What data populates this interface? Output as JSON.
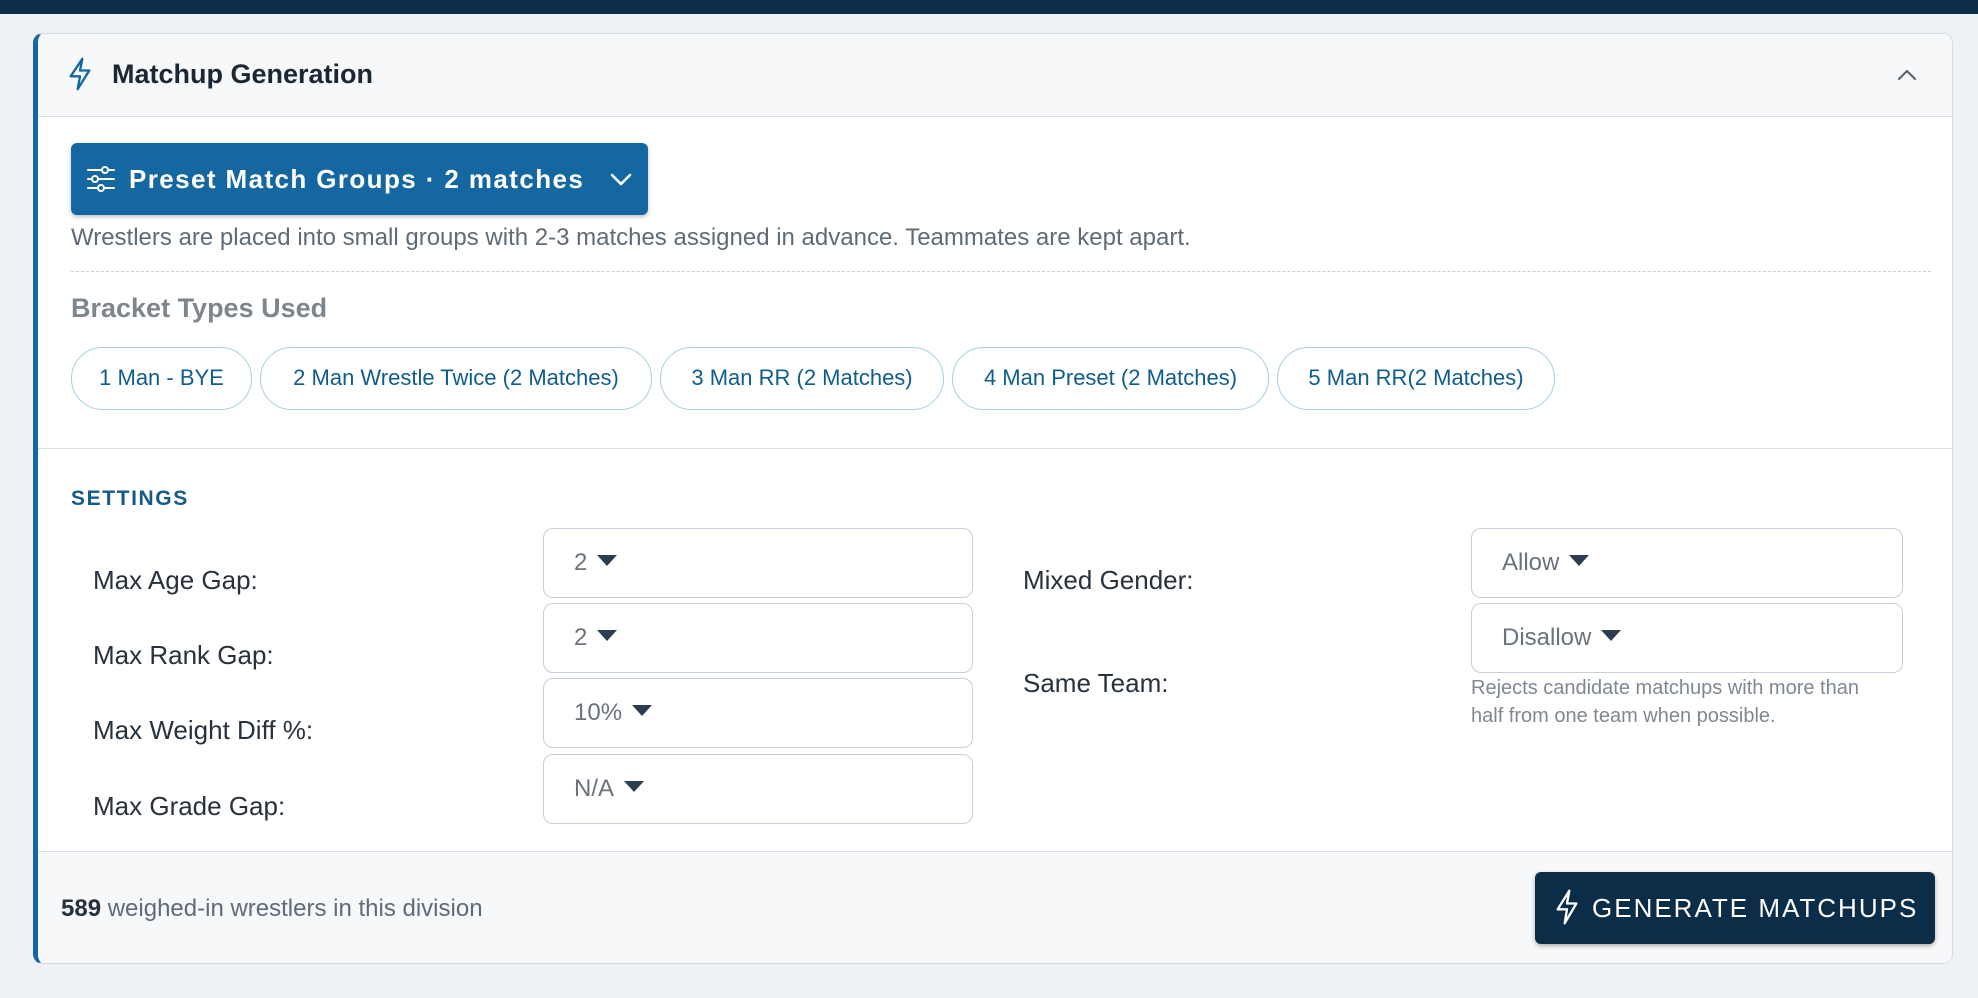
{
  "header": {
    "title": "Matchup Generation",
    "icon": "lightning-bolt-icon",
    "collapse_icon": "chevron-up-icon"
  },
  "preset": {
    "icon": "sliders-icon",
    "button_label": "Preset Match Groups · 2 matches",
    "chevron_icon": "chevron-down-icon",
    "description": "Wrestlers are placed into small groups with 2-3 matches assigned in advance. Teammates are kept apart."
  },
  "bracket_types": {
    "title": "Bracket Types Used",
    "items": [
      "1 Man - BYE",
      "2 Man Wrestle Twice (2 Matches)",
      "3 Man RR (2 Matches)",
      "4 Man Preset (2 Matches)",
      "5 Man RR(2 Matches)"
    ]
  },
  "settings": {
    "title": "SETTINGS",
    "max_age_gap": {
      "label": "Max Age Gap:",
      "value": "2"
    },
    "max_rank_gap": {
      "label": "Max Rank Gap:",
      "value": "2"
    },
    "max_weight_diff": {
      "label": "Max Weight Diff %:",
      "value": "10%"
    },
    "max_grade_gap": {
      "label": "Max Grade Gap:",
      "value": "N/A"
    },
    "mixed_gender": {
      "label": "Mixed Gender:",
      "value": "Allow"
    },
    "same_team": {
      "label": "Same Team:",
      "value": "Disallow",
      "help": "Rejects candidate matchups with more than half from one team when possible."
    }
  },
  "footer": {
    "count": "589",
    "count_suffix": " weighed-in wrestlers in this division",
    "generate_label": "GENERATE MATCHUPS",
    "generate_icon": "lightning-bolt-icon"
  },
  "colors": {
    "accent": "#1467a0",
    "dark": "#0c2d48",
    "pill_border": "#a6cfe0"
  }
}
